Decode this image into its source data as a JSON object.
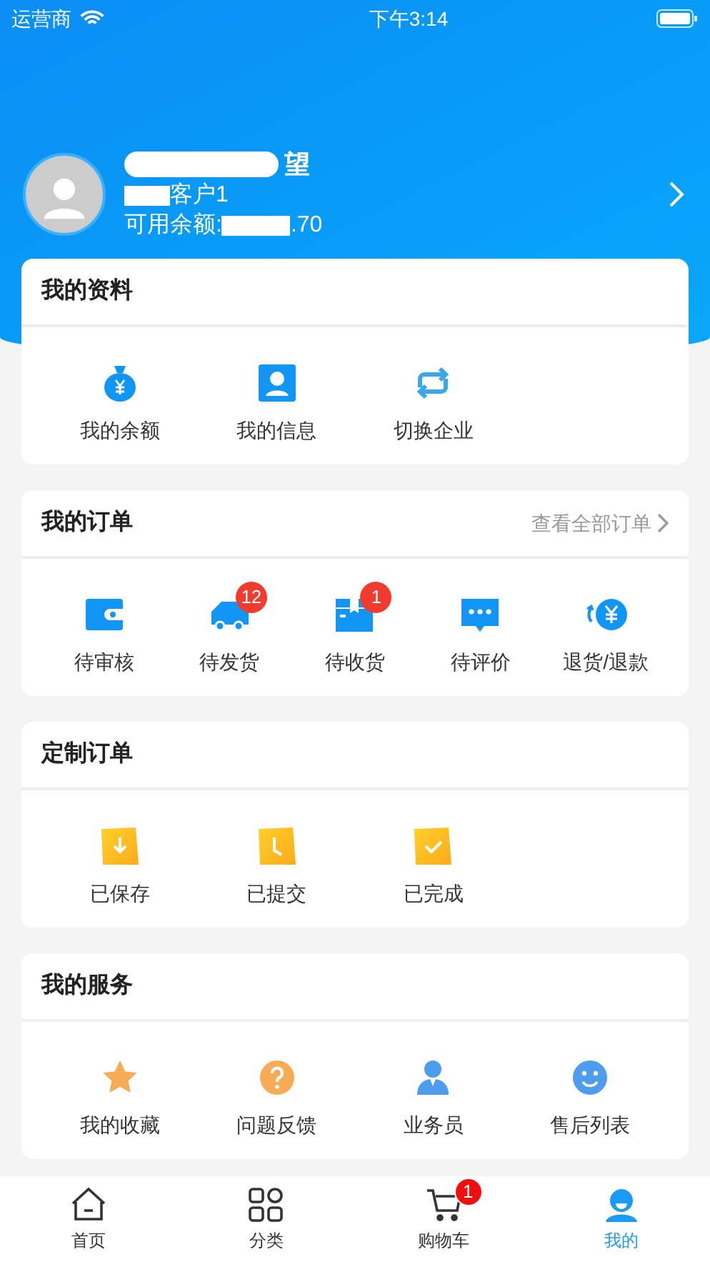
{
  "status_bar": {
    "carrier": "运营商",
    "time": "下午3:14"
  },
  "profile": {
    "name": "望",
    "account": "客户1",
    "balance_label": "可用余额:",
    "balance": ".70"
  },
  "sections": [
    {
      "title": "我的资料",
      "items": [
        {
          "label": "我的余额"
        },
        {
          "label": "我的信息"
        },
        {
          "label": "切换企业"
        }
      ]
    },
    {
      "title": "我的订单",
      "link": "查看全部订单",
      "items": [
        {
          "label": "待审核"
        },
        {
          "label": "待发货",
          "badge": "12"
        },
        {
          "label": "待收货",
          "badge": "1"
        },
        {
          "label": "待评价"
        },
        {
          "label": "退货/退款"
        }
      ]
    },
    {
      "title": "定制订单",
      "items": [
        {
          "label": "已保存"
        },
        {
          "label": "已提交"
        },
        {
          "label": "已完成"
        }
      ]
    },
    {
      "title": "我的服务",
      "items": [
        {
          "label": "我的收藏"
        },
        {
          "label": "问题反馈"
        },
        {
          "label": "业务员"
        },
        {
          "label": "售后列表"
        }
      ]
    }
  ],
  "tab_bar": [
    {
      "label": "首页",
      "selected": false
    },
    {
      "label": "分类",
      "selected": false
    },
    {
      "label": "购物车",
      "badge": "1",
      "selected": false
    },
    {
      "label": "我的",
      "selected": true
    }
  ]
}
